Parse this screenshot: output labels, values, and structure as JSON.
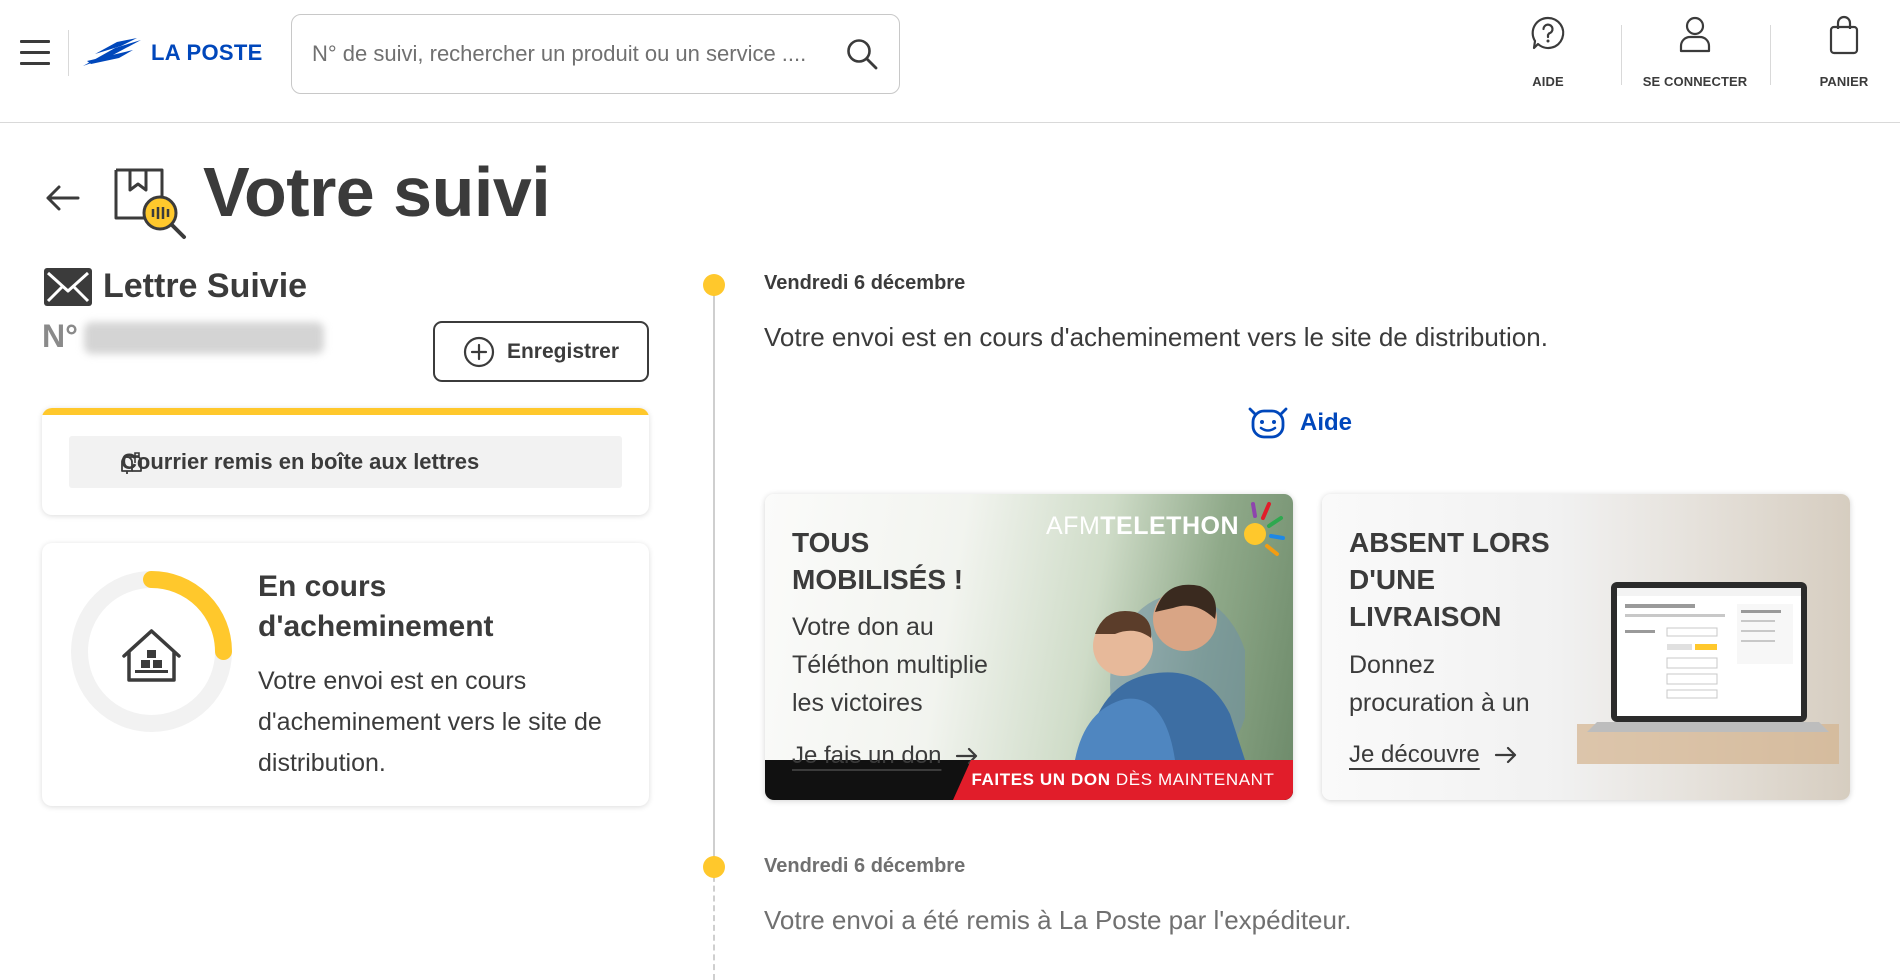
{
  "header": {
    "menu_label": "Menu",
    "logo_text": "LA POSTE",
    "search": {
      "placeholder": "N° de suivi, rechercher un produit ou un service ...."
    },
    "actions": [
      {
        "label": "AIDE",
        "icon": "help-circle-icon"
      },
      {
        "label": "SE CONNECTER",
        "icon": "user-icon"
      },
      {
        "label": "PANIER",
        "icon": "shopping-bag-icon"
      }
    ]
  },
  "page": {
    "title": "Votre suivi"
  },
  "shipment": {
    "product": "Lettre Suivie",
    "number_label": "N°",
    "number_value": "2L0947622332",
    "save_label": "Enregistrer",
    "delivery_mode": "Courrier remis en boîte aux lettres",
    "status_title": "En cours d'acheminement",
    "status_description": "Votre envoi est en cours d'acheminement vers le site de distribution.",
    "progress": 0.25
  },
  "timeline": [
    {
      "date": "Vendredi 6 décembre",
      "text": "Votre envoi est en cours d'acheminement vers le site de distribution."
    },
    {
      "date": "Vendredi 6 décembre",
      "text": "Votre envoi a été remis à La Poste par l'expéditeur."
    }
  ],
  "help_link": "Aide",
  "promos": [
    {
      "title_line1": "TOUS",
      "title_line2": "MOBILISÉS !",
      "desc_line1": "Votre don au",
      "desc_line2": "Téléthon multiplie",
      "desc_line3": "les victoires",
      "cta": "Je fais un don",
      "brand_light": "AFM",
      "brand_bold": "TELETHON",
      "band_bold": "FAITES UN DON",
      "band_light": "DÈS MAINTENANT"
    },
    {
      "title_line1": "ABSENT LORS",
      "title_line2": "D'UNE",
      "title_line3": "LIVRAISON",
      "desc_line1": "Donnez",
      "desc_line2": "procuration à un",
      "cta": "Je découvre"
    }
  ],
  "colors": {
    "brand_blue": "#0047bb",
    "accent_yellow": "#ffc82c",
    "text": "#3b3b3b",
    "telethon_red": "#e11d2a"
  }
}
